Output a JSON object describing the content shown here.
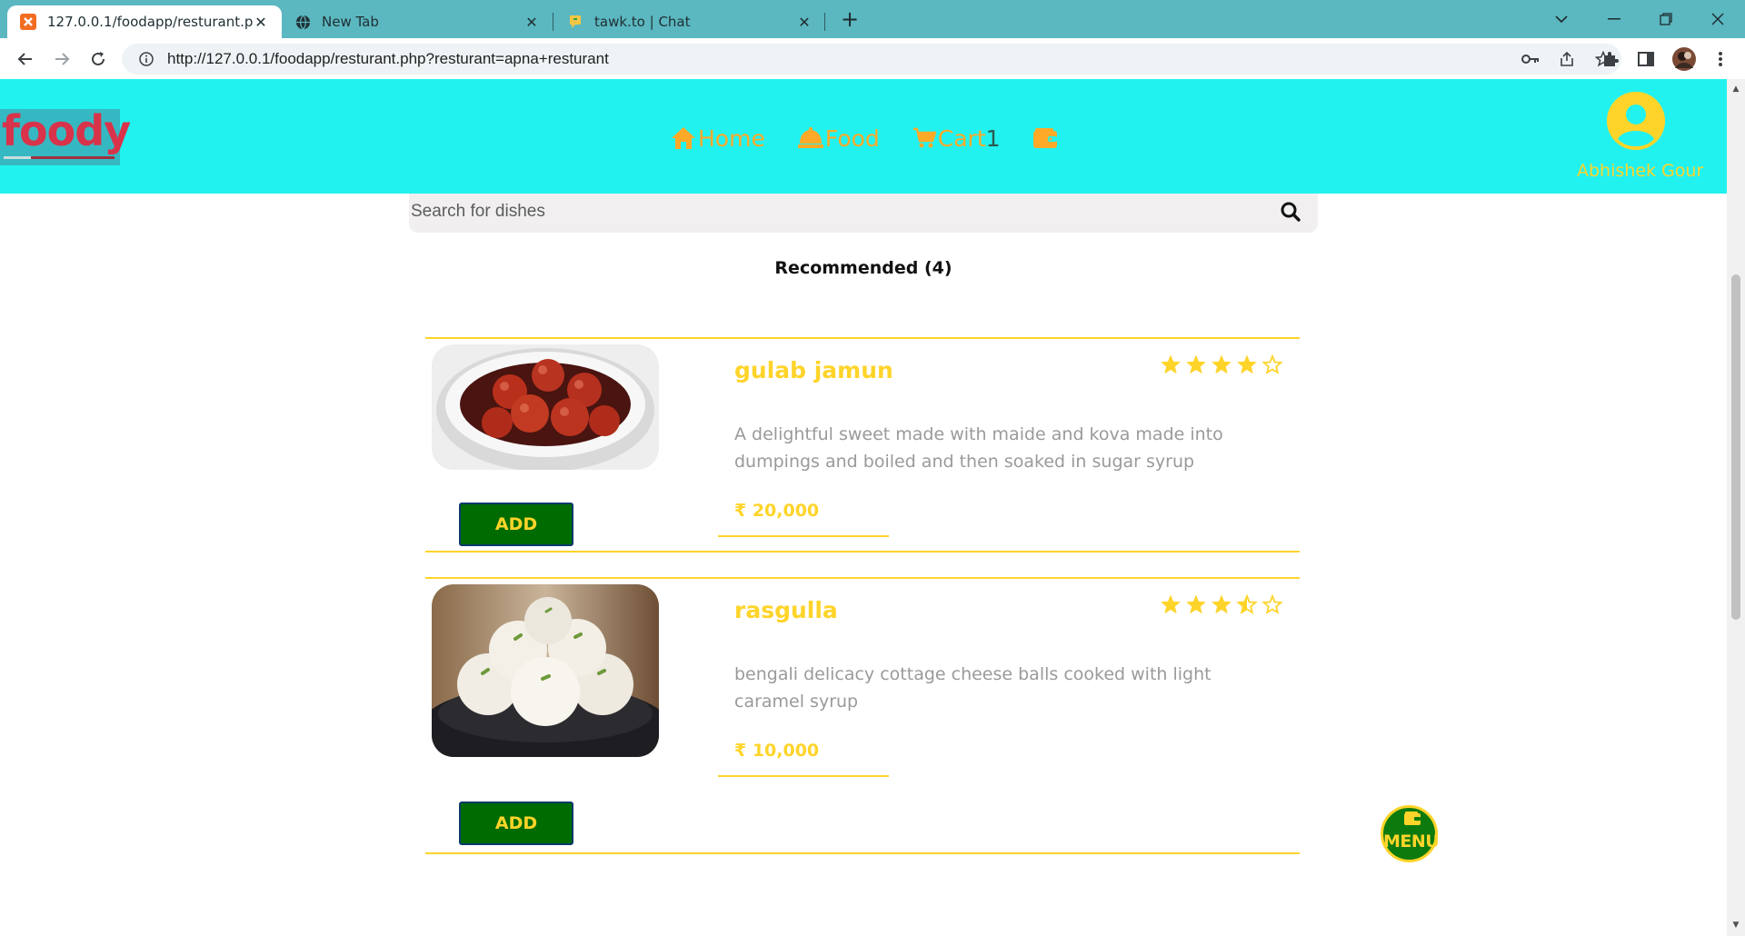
{
  "browser": {
    "tabs": [
      {
        "title": "127.0.0.1/foodapp/resturant.php",
        "active": true
      },
      {
        "title": "New Tab",
        "active": false
      },
      {
        "title": "tawk.to | Chat",
        "active": false
      }
    ],
    "url": "http://127.0.0.1/foodapp/resturant.php?resturant=apna+resturant"
  },
  "header": {
    "logo_text": "foody",
    "nav": [
      {
        "label": "Home",
        "icon": "home-icon"
      },
      {
        "label": "Food",
        "icon": "food-icon"
      },
      {
        "label": "Cart",
        "icon": "cart-icon",
        "count": "1"
      },
      {
        "label": "",
        "icon": "wallet-icon"
      }
    ],
    "user_name": "Abhishek Gour",
    "colors": {
      "bar": "#22f2ef",
      "accent": "#ffa928",
      "user": "#ffd42a"
    }
  },
  "search": {
    "placeholder": "Search for dishes"
  },
  "section": {
    "title": "Recommended (4)"
  },
  "dishes": [
    {
      "name": "gulab jamun",
      "rating": 4,
      "description": "A delightful sweet made with maide and kova made into dumpings and boiled and then soaked in sugar syrup",
      "price": "₹ 20,000",
      "add_label": "ADD"
    },
    {
      "name": "rasgulla",
      "rating": 3.5,
      "description": "bengali delicacy cottage cheese balls cooked with light caramel syrup",
      "price": "₹ 10,000",
      "add_label": "ADD"
    }
  ],
  "menu_fab": {
    "label": "MENU"
  }
}
